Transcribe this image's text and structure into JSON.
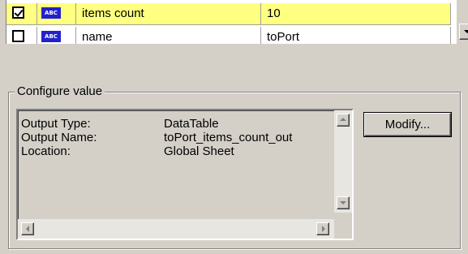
{
  "grid": {
    "rows": [
      {
        "checked": true,
        "type_icon": "ABC",
        "name": "items count",
        "value": "10",
        "highlight": "#ffff80"
      },
      {
        "checked": false,
        "type_icon": "ABC",
        "name": "name",
        "value": "toPort",
        "highlight": "#ffffff"
      }
    ]
  },
  "configure": {
    "title": "Configure value",
    "fields": [
      {
        "label": "Output Type:",
        "value": "DataTable"
      },
      {
        "label": "Output Name:",
        "value": "toPort_items_count_out"
      },
      {
        "label": "Location:",
        "value": "Global Sheet"
      }
    ],
    "modify_label": "Modify..."
  },
  "icons": {
    "scroll_down": "chevron-down-icon",
    "scroll_up": "chevron-up-icon",
    "scroll_left": "chevron-left-icon",
    "scroll_right": "chevron-right-icon"
  }
}
